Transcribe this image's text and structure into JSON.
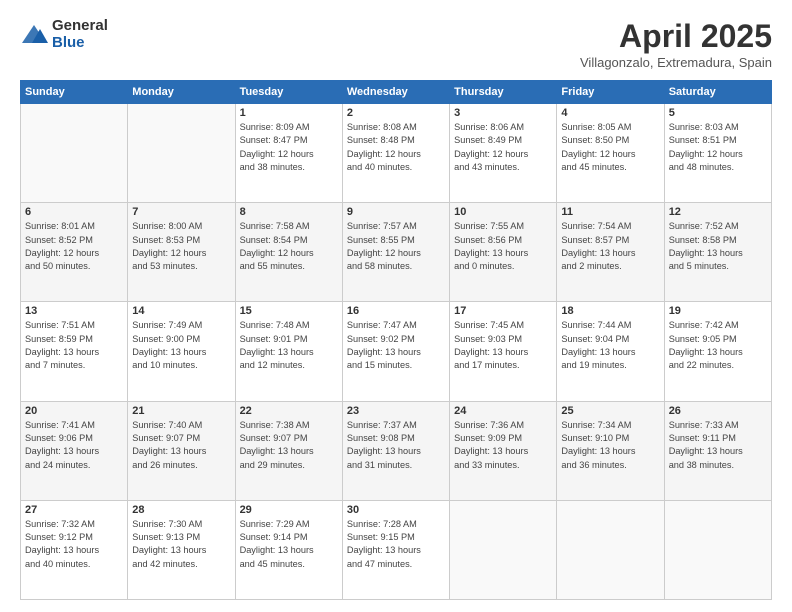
{
  "header": {
    "logo_general": "General",
    "logo_blue": "Blue",
    "title": "April 2025",
    "location": "Villagonzalo, Extremadura, Spain"
  },
  "days_of_week": [
    "Sunday",
    "Monday",
    "Tuesday",
    "Wednesday",
    "Thursday",
    "Friday",
    "Saturday"
  ],
  "weeks": [
    [
      {
        "day": "",
        "info": ""
      },
      {
        "day": "",
        "info": ""
      },
      {
        "day": "1",
        "info": "Sunrise: 8:09 AM\nSunset: 8:47 PM\nDaylight: 12 hours\nand 38 minutes."
      },
      {
        "day": "2",
        "info": "Sunrise: 8:08 AM\nSunset: 8:48 PM\nDaylight: 12 hours\nand 40 minutes."
      },
      {
        "day": "3",
        "info": "Sunrise: 8:06 AM\nSunset: 8:49 PM\nDaylight: 12 hours\nand 43 minutes."
      },
      {
        "day": "4",
        "info": "Sunrise: 8:05 AM\nSunset: 8:50 PM\nDaylight: 12 hours\nand 45 minutes."
      },
      {
        "day": "5",
        "info": "Sunrise: 8:03 AM\nSunset: 8:51 PM\nDaylight: 12 hours\nand 48 minutes."
      }
    ],
    [
      {
        "day": "6",
        "info": "Sunrise: 8:01 AM\nSunset: 8:52 PM\nDaylight: 12 hours\nand 50 minutes."
      },
      {
        "day": "7",
        "info": "Sunrise: 8:00 AM\nSunset: 8:53 PM\nDaylight: 12 hours\nand 53 minutes."
      },
      {
        "day": "8",
        "info": "Sunrise: 7:58 AM\nSunset: 8:54 PM\nDaylight: 12 hours\nand 55 minutes."
      },
      {
        "day": "9",
        "info": "Sunrise: 7:57 AM\nSunset: 8:55 PM\nDaylight: 12 hours\nand 58 minutes."
      },
      {
        "day": "10",
        "info": "Sunrise: 7:55 AM\nSunset: 8:56 PM\nDaylight: 13 hours\nand 0 minutes."
      },
      {
        "day": "11",
        "info": "Sunrise: 7:54 AM\nSunset: 8:57 PM\nDaylight: 13 hours\nand 2 minutes."
      },
      {
        "day": "12",
        "info": "Sunrise: 7:52 AM\nSunset: 8:58 PM\nDaylight: 13 hours\nand 5 minutes."
      }
    ],
    [
      {
        "day": "13",
        "info": "Sunrise: 7:51 AM\nSunset: 8:59 PM\nDaylight: 13 hours\nand 7 minutes."
      },
      {
        "day": "14",
        "info": "Sunrise: 7:49 AM\nSunset: 9:00 PM\nDaylight: 13 hours\nand 10 minutes."
      },
      {
        "day": "15",
        "info": "Sunrise: 7:48 AM\nSunset: 9:01 PM\nDaylight: 13 hours\nand 12 minutes."
      },
      {
        "day": "16",
        "info": "Sunrise: 7:47 AM\nSunset: 9:02 PM\nDaylight: 13 hours\nand 15 minutes."
      },
      {
        "day": "17",
        "info": "Sunrise: 7:45 AM\nSunset: 9:03 PM\nDaylight: 13 hours\nand 17 minutes."
      },
      {
        "day": "18",
        "info": "Sunrise: 7:44 AM\nSunset: 9:04 PM\nDaylight: 13 hours\nand 19 minutes."
      },
      {
        "day": "19",
        "info": "Sunrise: 7:42 AM\nSunset: 9:05 PM\nDaylight: 13 hours\nand 22 minutes."
      }
    ],
    [
      {
        "day": "20",
        "info": "Sunrise: 7:41 AM\nSunset: 9:06 PM\nDaylight: 13 hours\nand 24 minutes."
      },
      {
        "day": "21",
        "info": "Sunrise: 7:40 AM\nSunset: 9:07 PM\nDaylight: 13 hours\nand 26 minutes."
      },
      {
        "day": "22",
        "info": "Sunrise: 7:38 AM\nSunset: 9:07 PM\nDaylight: 13 hours\nand 29 minutes."
      },
      {
        "day": "23",
        "info": "Sunrise: 7:37 AM\nSunset: 9:08 PM\nDaylight: 13 hours\nand 31 minutes."
      },
      {
        "day": "24",
        "info": "Sunrise: 7:36 AM\nSunset: 9:09 PM\nDaylight: 13 hours\nand 33 minutes."
      },
      {
        "day": "25",
        "info": "Sunrise: 7:34 AM\nSunset: 9:10 PM\nDaylight: 13 hours\nand 36 minutes."
      },
      {
        "day": "26",
        "info": "Sunrise: 7:33 AM\nSunset: 9:11 PM\nDaylight: 13 hours\nand 38 minutes."
      }
    ],
    [
      {
        "day": "27",
        "info": "Sunrise: 7:32 AM\nSunset: 9:12 PM\nDaylight: 13 hours\nand 40 minutes."
      },
      {
        "day": "28",
        "info": "Sunrise: 7:30 AM\nSunset: 9:13 PM\nDaylight: 13 hours\nand 42 minutes."
      },
      {
        "day": "29",
        "info": "Sunrise: 7:29 AM\nSunset: 9:14 PM\nDaylight: 13 hours\nand 45 minutes."
      },
      {
        "day": "30",
        "info": "Sunrise: 7:28 AM\nSunset: 9:15 PM\nDaylight: 13 hours\nand 47 minutes."
      },
      {
        "day": "",
        "info": ""
      },
      {
        "day": "",
        "info": ""
      },
      {
        "day": "",
        "info": ""
      }
    ]
  ]
}
